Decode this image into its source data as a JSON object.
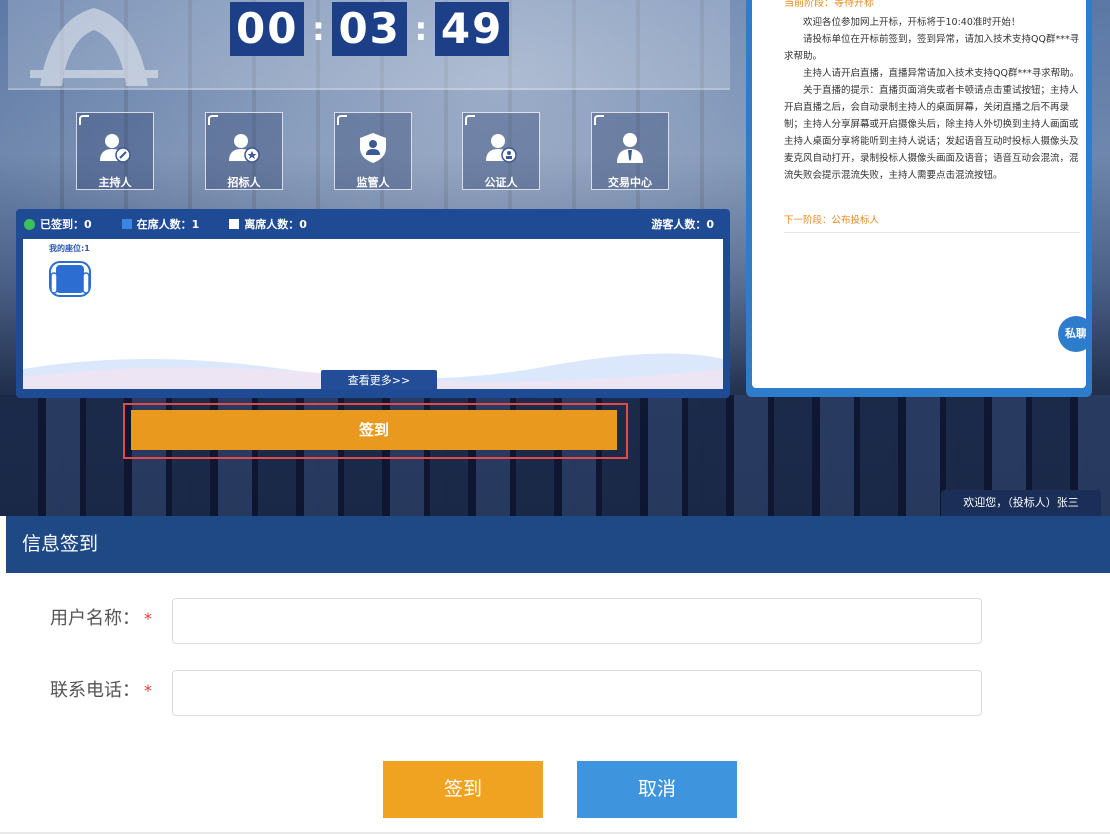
{
  "timer": {
    "hours": "00",
    "minutes": "03",
    "seconds": "49",
    "sep": ":"
  },
  "roles": [
    {
      "label": "主持人",
      "icon": "host-icon"
    },
    {
      "label": "招标人",
      "icon": "tenderer-icon"
    },
    {
      "label": "监管人",
      "icon": "supervisor-icon"
    },
    {
      "label": "公证人",
      "icon": "notary-icon"
    },
    {
      "label": "交易中心",
      "icon": "trading-center-icon"
    }
  ],
  "seats": {
    "signed": "已签到：0",
    "present": "在席人数：1",
    "absent": "离席人数：0",
    "visitors": "游客人数：0",
    "my_seat": "我的座位:1",
    "more": "查看更多>>"
  },
  "sign_button": "签到",
  "notice": {
    "phase": "当前阶段：等待开标",
    "paragraphs": [
      "欢迎各位参加网上开标，开标将于10:40准时开始！",
      "请投标单位在开标前签到，签到异常，请加入技术支持QQ群***寻求帮助。",
      "主持人请开启直播，直播异常请加入技术支持QQ群***寻求帮助。",
      "关于直播的提示：直播页面消失或者卡顿请点击重试按钮；主持人开启直播之后，会自动录制主持人的桌面屏幕，关闭直播之后不再录制；主持人分享屏幕或开启摄像头后，除主持人外切换到主持人画面或主持人桌面分享将能听到主持人说话；发起语音互动时投标人摄像头及麦克风自动打开，录制投标人摄像头画面及语音；语音互动会混流，混流失败会提示混流失败，主持人需要点击混流按钮。"
    ],
    "next": "下一阶段：公布投标人",
    "private_chat": "私聊"
  },
  "welcome": "欢迎您，（投标人）张三",
  "dialog": {
    "title": "信息签到",
    "username_label": "用户名称：",
    "username_value": "",
    "phone_label": "联系电话：",
    "phone_value": "",
    "required_mark": "*",
    "ok": "签到",
    "cancel": "取消"
  },
  "colors": {
    "accent": "#e9991e",
    "primary": "#1f4984",
    "cancel": "#3e95de",
    "phase": "#e88a1e"
  }
}
